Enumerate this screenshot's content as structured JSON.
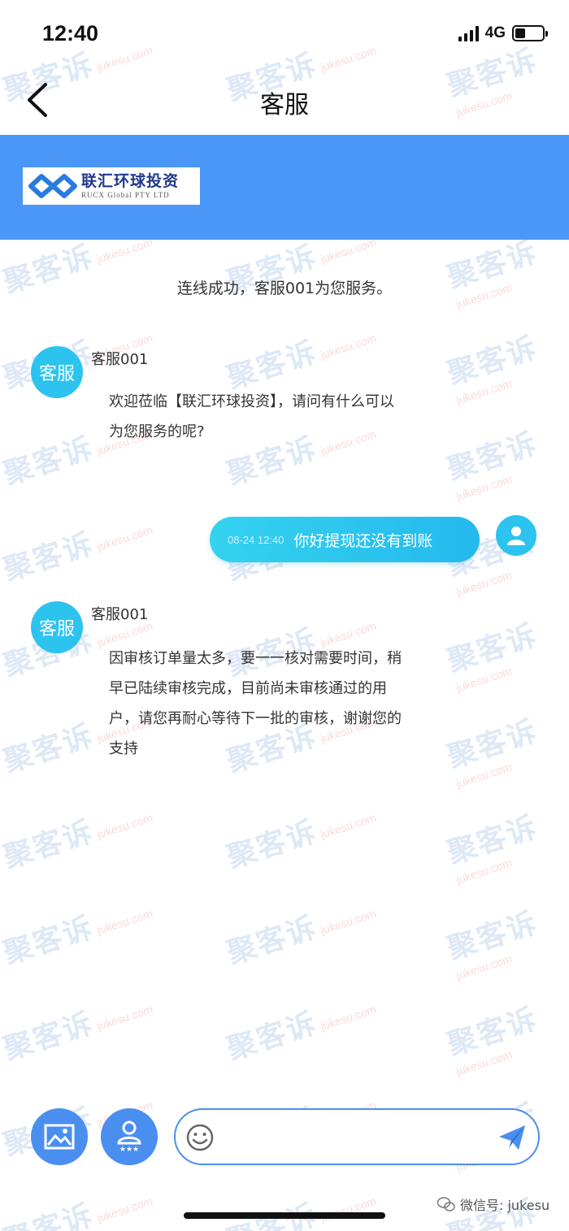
{
  "status_bar": {
    "time": "12:40",
    "network": "4G"
  },
  "nav": {
    "title": "客服"
  },
  "banner": {
    "logo_cn": "联汇环球投资",
    "logo_en": "RUCX Global PTY LTD"
  },
  "system_notice": "连线成功，客服001为您服务。",
  "messages": [
    {
      "sender": "agent",
      "avatar_label": "客服",
      "name": "客服001",
      "lines": [
        "欢迎莅临【联汇环球投资】，请问有什么可以",
        "为您服务的呢?"
      ]
    },
    {
      "sender": "user",
      "time": "08-24 12:40",
      "text": "你好提现还没有到账"
    },
    {
      "sender": "agent",
      "avatar_label": "客服",
      "name": "客服001",
      "lines": [
        "因审核订单量太多，要一一核对需要时间，稍",
        "早已陆续审核完成，目前尚未审核通过的用",
        "户，请您再耐心等待下一批的审核，谢谢您的",
        "支持"
      ]
    }
  ],
  "watermark": {
    "cn": "聚客诉",
    "en": "jukesu.com"
  },
  "input": {
    "placeholder": ""
  },
  "footer": {
    "wechat_label": "微信号: jukesu"
  },
  "colors": {
    "banner": "#4a97f8",
    "bubble": "#2cc3ef",
    "tool_button": "#4a8ff0"
  },
  "icons": {
    "back": "chevron-left-icon",
    "image": "image-icon",
    "rating": "rate-agent-icon",
    "emoji": "smiley-icon",
    "send": "paper-plane-icon",
    "user": "user-icon"
  }
}
